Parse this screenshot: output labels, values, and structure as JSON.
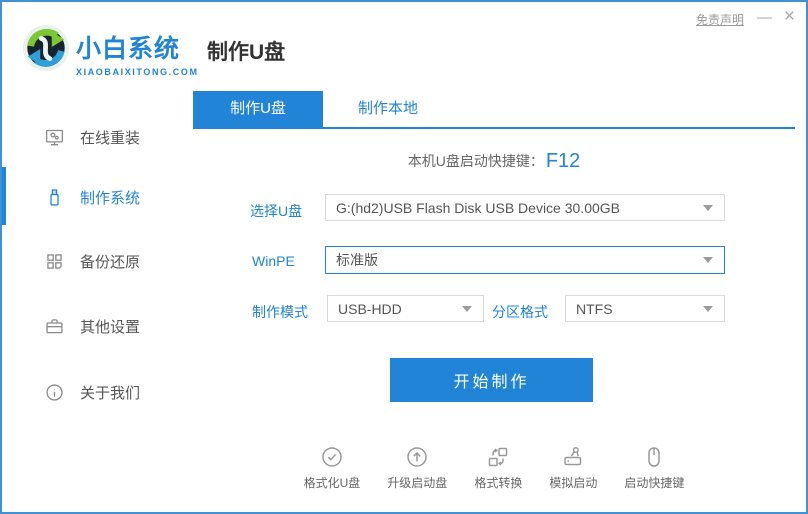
{
  "window": {
    "titlebar": {
      "disclaimer": "免责声明",
      "minimize": "—",
      "close": "×"
    },
    "brand": {
      "name": "小白系统",
      "domain": "XIAOBAIXITONG.COM"
    },
    "page_title": "制作U盘"
  },
  "sidebar": {
    "items": [
      {
        "label": "在线重装",
        "icon": "monitor-icon",
        "active": false
      },
      {
        "label": "制作系统",
        "icon": "usb-drive-icon",
        "active": true
      },
      {
        "label": "备份还原",
        "icon": "grid-icon",
        "active": false
      },
      {
        "label": "其他设置",
        "icon": "briefcase-icon",
        "active": false
      },
      {
        "label": "关于我们",
        "icon": "info-icon",
        "active": false
      }
    ]
  },
  "tabs": [
    {
      "label": "制作U盘",
      "active": true
    },
    {
      "label": "制作本地",
      "active": false
    }
  ],
  "main": {
    "hotkey_hint": {
      "prefix": "本机U盘启动快捷键：",
      "key": "F12"
    },
    "fields": {
      "usb_select": {
        "label": "选择U盘",
        "value": "G:(hd2)USB Flash Disk USB Device 30.00GB"
      },
      "winpe": {
        "label": "WinPE",
        "value": "标准版"
      },
      "mode": {
        "label": "制作模式",
        "value": "USB-HDD"
      },
      "partition": {
        "label": "分区格式",
        "value": "NTFS"
      }
    },
    "start_button": "开始制作",
    "tools": [
      {
        "label": "格式化U盘",
        "icon": "check-circle-icon"
      },
      {
        "label": "升级启动盘",
        "icon": "arrow-up-circle-icon"
      },
      {
        "label": "格式转换",
        "icon": "convert-icon"
      },
      {
        "label": "模拟启动",
        "icon": "stamp-icon"
      },
      {
        "label": "启动快捷键",
        "icon": "mouse-icon"
      }
    ]
  },
  "colors": {
    "accent": "#2184d6",
    "border": "#4191d5",
    "muted": "#999999"
  }
}
